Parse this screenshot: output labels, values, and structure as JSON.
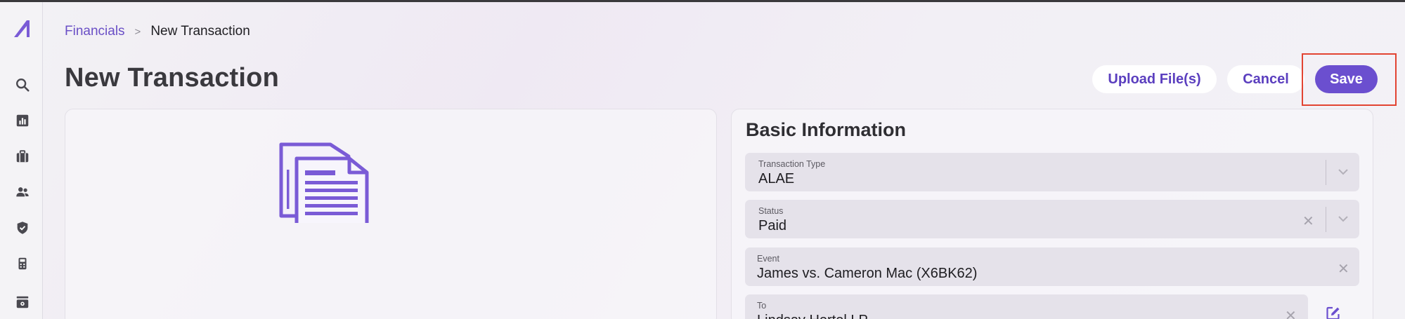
{
  "breadcrumb": {
    "parent": "Financials",
    "separator": ">",
    "current": "New Transaction"
  },
  "page": {
    "title": "New Transaction"
  },
  "actions": {
    "upload": "Upload File(s)",
    "cancel": "Cancel",
    "save": "Save"
  },
  "sidebar": {
    "logo": "app-logo",
    "icons": [
      "search-icon",
      "analytics-icon",
      "briefcase-icon",
      "users-icon",
      "shield-icon",
      "calculator-icon",
      "billing-icon"
    ]
  },
  "basic_info": {
    "title": "Basic Information",
    "fields": [
      {
        "label": "Transaction Type",
        "value": "ALAE"
      },
      {
        "label": "Status",
        "value": "Paid"
      },
      {
        "label": "Event",
        "value": "James vs. Cameron Mac (X6BK62)"
      },
      {
        "label": "To",
        "value": "Lindsay Hertel LP"
      }
    ]
  },
  "colors": {
    "accent": "#6b4fcf",
    "highlight": "#e24432"
  }
}
